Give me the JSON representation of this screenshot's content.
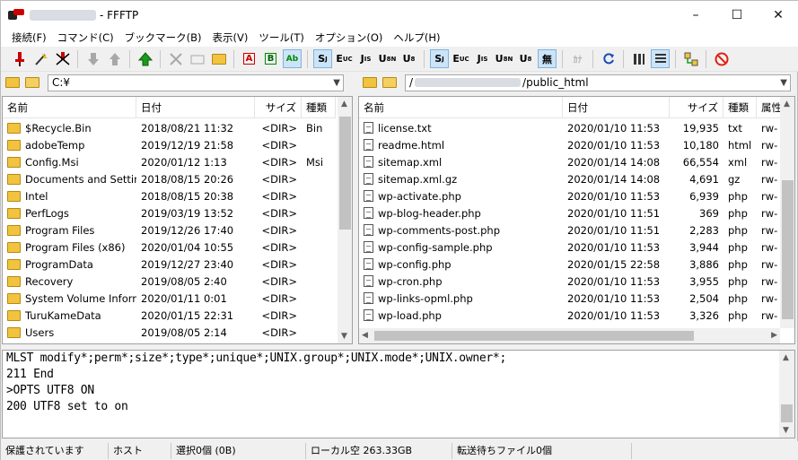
{
  "window": {
    "title": "- FFFTP",
    "minimize_icon": "–",
    "maximize_icon": "☐",
    "close_icon": "✕"
  },
  "menu": [
    "接続(F)",
    "コマンド(C)",
    "ブックマーク(B)",
    "表示(V)",
    "ツール(T)",
    "オプション(O)",
    "ヘルプ(H)"
  ],
  "toolbar": {
    "sjis": "S",
    "euc": "E",
    "jis": "J",
    "utf8n": "U",
    "utf8": "U",
    "none": "無",
    "kana": "ｶﾅ",
    "A": "A",
    "B": "B",
    "auto": "Ab"
  },
  "local": {
    "path": "C:¥",
    "columns": {
      "name": "名前",
      "date": "日付",
      "size": "サイズ",
      "type": "種類"
    },
    "rows": [
      {
        "name": "$Recycle.Bin",
        "date": "2018/08/21 11:32",
        "size": "<DIR>",
        "type": "Bin"
      },
      {
        "name": "adobeTemp",
        "date": "2019/12/19 21:58",
        "size": "<DIR>",
        "type": ""
      },
      {
        "name": "Config.Msi",
        "date": "2020/01/12  1:13",
        "size": "<DIR>",
        "type": "Msi"
      },
      {
        "name": "Documents and Settin...",
        "date": "2018/08/15 20:26",
        "size": "<DIR>",
        "type": ""
      },
      {
        "name": "Intel",
        "date": "2018/08/15 20:38",
        "size": "<DIR>",
        "type": ""
      },
      {
        "name": "PerfLogs",
        "date": "2019/03/19 13:52",
        "size": "<DIR>",
        "type": ""
      },
      {
        "name": "Program Files",
        "date": "2019/12/26 17:40",
        "size": "<DIR>",
        "type": ""
      },
      {
        "name": "Program Files (x86)",
        "date": "2020/01/04 10:55",
        "size": "<DIR>",
        "type": ""
      },
      {
        "name": "ProgramData",
        "date": "2019/12/27 23:40",
        "size": "<DIR>",
        "type": ""
      },
      {
        "name": "Recovery",
        "date": "2019/08/05  2:40",
        "size": "<DIR>",
        "type": ""
      },
      {
        "name": "System Volume Inform...",
        "date": "2020/01/11  0:01",
        "size": "<DIR>",
        "type": ""
      },
      {
        "name": "TuruKameData",
        "date": "2020/01/15 22:31",
        "size": "<DIR>",
        "type": ""
      },
      {
        "name": "Users",
        "date": "2019/08/05  2:14",
        "size": "<DIR>",
        "type": ""
      }
    ]
  },
  "remote": {
    "path_prefix": "/",
    "path_suffix": "/public_html",
    "columns": {
      "name": "名前",
      "date": "日付",
      "size": "サイズ",
      "type": "種類",
      "attr": "属性"
    },
    "rows": [
      {
        "name": "license.txt",
        "date": "2020/01/10 11:53",
        "size": "19,935",
        "type": "txt",
        "attr": "rw-"
      },
      {
        "name": "readme.html",
        "date": "2020/01/10 11:53",
        "size": "10,180",
        "type": "html",
        "attr": "rw-"
      },
      {
        "name": "sitemap.xml",
        "date": "2020/01/14 14:08",
        "size": "66,554",
        "type": "xml",
        "attr": "rw-"
      },
      {
        "name": "sitemap.xml.gz",
        "date": "2020/01/14 14:08",
        "size": "4,691",
        "type": "gz",
        "attr": "rw-"
      },
      {
        "name": "wp-activate.php",
        "date": "2020/01/10 11:53",
        "size": "6,939",
        "type": "php",
        "attr": "rw-"
      },
      {
        "name": "wp-blog-header.php",
        "date": "2020/01/10 11:51",
        "size": "369",
        "type": "php",
        "attr": "rw-"
      },
      {
        "name": "wp-comments-post.php",
        "date": "2020/01/10 11:51",
        "size": "2,283",
        "type": "php",
        "attr": "rw-"
      },
      {
        "name": "wp-config-sample.php",
        "date": "2020/01/10 11:53",
        "size": "3,944",
        "type": "php",
        "attr": "rw-"
      },
      {
        "name": "wp-config.php",
        "date": "2020/01/15 22:58",
        "size": "3,886",
        "type": "php",
        "attr": "rw-"
      },
      {
        "name": "wp-cron.php",
        "date": "2020/01/10 11:53",
        "size": "3,955",
        "type": "php",
        "attr": "rw-"
      },
      {
        "name": "wp-links-opml.php",
        "date": "2020/01/10 11:53",
        "size": "2,504",
        "type": "php",
        "attr": "rw-"
      },
      {
        "name": "wp-load.php",
        "date": "2020/01/10 11:53",
        "size": "3,326",
        "type": "php",
        "attr": "rw-"
      }
    ]
  },
  "log": [
    " MLST modify*;perm*;size*;type*;unique*;UNIX.group*;UNIX.mode*;UNIX.owner*;",
    "211 End",
    ">OPTS UTF8 ON",
    "200 UTF8 set to on"
  ],
  "status": {
    "security": "保護されています",
    "host": "ホスト",
    "selection": "選択0個 (0B)",
    "local_free": "ローカル空 263.33GB",
    "queue": "転送待ちファイル0個"
  },
  "colors": {
    "highlight": "#e0141e",
    "selected_toolbar": "#cce4f7"
  }
}
